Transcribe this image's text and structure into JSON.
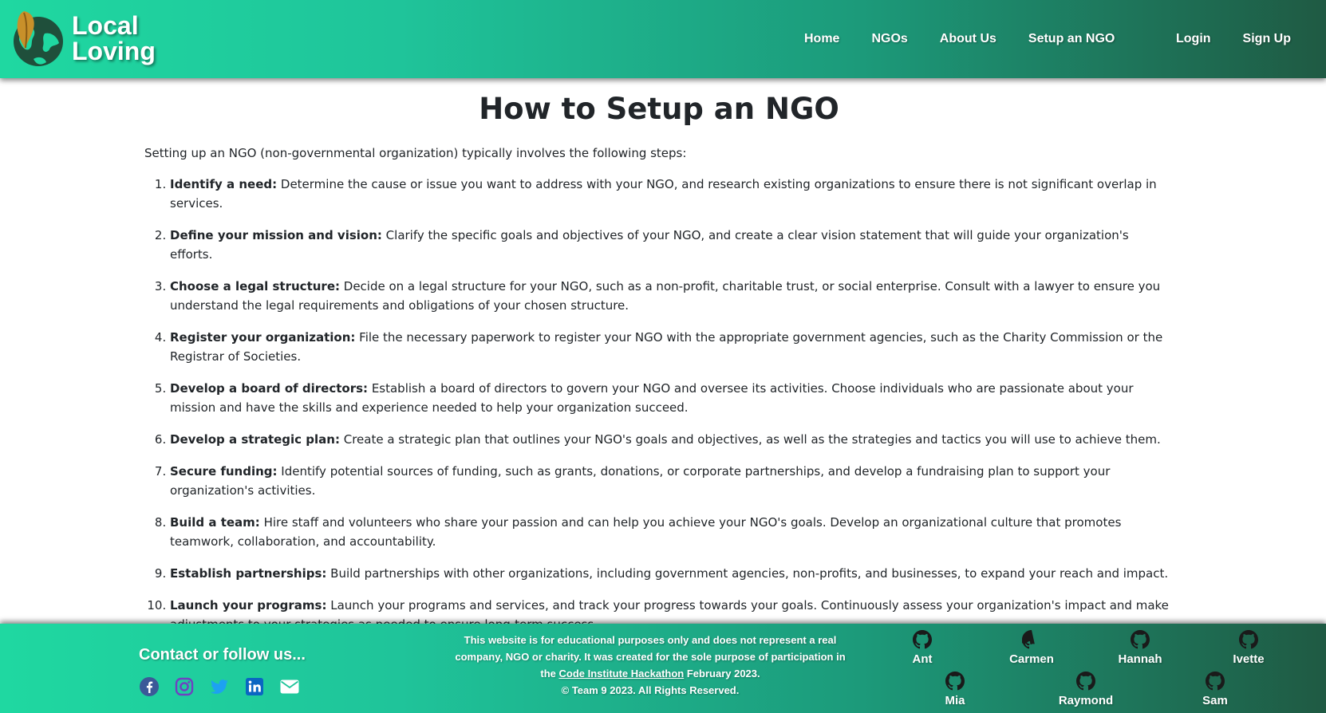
{
  "brand": {
    "line1": "Local",
    "line2": "Loving",
    "logo_icon": "globe-leaf-icon"
  },
  "nav": {
    "home": "Home",
    "ngos": "NGOs",
    "about": "About Us",
    "setup": "Setup an NGO",
    "login": "Login",
    "signup": "Sign Up"
  },
  "main": {
    "title": "How to Setup an NGO",
    "intro": "Setting up an NGO (non-governmental organization) typically involves the following steps:",
    "steps": [
      {
        "title": "Identify a need:",
        "text": " Determine the cause or issue you want to address with your NGO, and research existing organizations to ensure there is not significant overlap in services."
      },
      {
        "title": "Define your mission and vision:",
        "text": " Clarify the specific goals and objectives of your NGO, and create a clear vision statement that will guide your organization's efforts."
      },
      {
        "title": "Choose a legal structure:",
        "text": " Decide on a legal structure for your NGO, such as a non-profit, charitable trust, or social enterprise. Consult with a lawyer to ensure you understand the legal requirements and obligations of your chosen structure."
      },
      {
        "title": "Register your organization:",
        "text": " File the necessary paperwork to register your NGO with the appropriate government agencies, such as the Charity Commission or the Registrar of Societies."
      },
      {
        "title": "Develop a board of directors:",
        "text": " Establish a board of directors to govern your NGO and oversee its activities. Choose individuals who are passionate about your mission and have the skills and experience needed to help your organization succeed."
      },
      {
        "title": "Develop a strategic plan:",
        "text": " Create a strategic plan that outlines your NGO's goals and objectives, as well as the strategies and tactics you will use to achieve them."
      },
      {
        "title": "Secure funding:",
        "text": " Identify potential sources of funding, such as grants, donations, or corporate partnerships, and develop a fundraising plan to support your organization's activities."
      },
      {
        "title": "Build a team:",
        "text": " Hire staff and volunteers who share your passion and can help you achieve your NGO's goals. Develop an organizational culture that promotes teamwork, collaboration, and accountability."
      },
      {
        "title": "Establish partnerships:",
        "text": " Build partnerships with other organizations, including government agencies, non-profits, and businesses, to expand your reach and impact."
      },
      {
        "title": "Launch your programs:",
        "text": " Launch your programs and services, and track your progress towards your goals. Continuously assess your organization's impact and make adjustments to your strategies as needed to ensure long-term success."
      }
    ]
  },
  "footer": {
    "contact_title": "Contact or follow us...",
    "social_icons": [
      "facebook-icon",
      "instagram-icon",
      "twitter-icon",
      "linkedin-icon",
      "envelope-icon"
    ],
    "disclaimer_part1": "This website is for educational purposes only and does not represent a real company, NGO or charity. It was created for the sole purpose of participation in the ",
    "disclaimer_link": "Code Institute Hackathon",
    "disclaimer_part2": " February 2023.",
    "copyright": "© Team 9 2023. All Rights Reserved.",
    "team": [
      "Ant",
      "Carmen",
      "Hannah",
      "Ivette",
      "Mia",
      "Raymond",
      "Sam"
    ],
    "team_icon": "github-icon"
  },
  "colors": {
    "gradient_start": "#1fd8a1",
    "gradient_end": "#1f5a43",
    "facebook": "#3b5998",
    "instagram": "#6f42c1",
    "twitter": "#1da1f2",
    "linkedin": "#0a66c2",
    "envelope": "#ffffff"
  }
}
